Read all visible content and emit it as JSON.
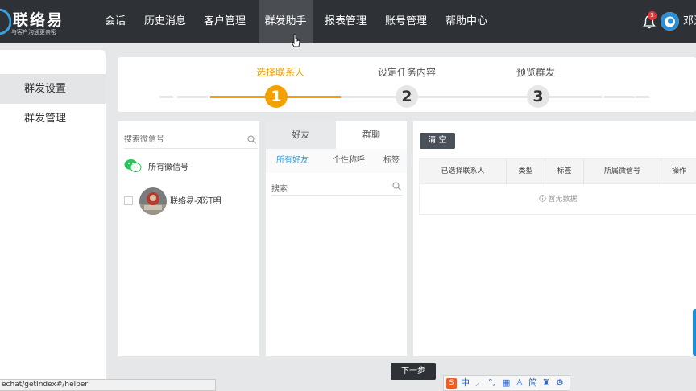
{
  "app": {
    "logo_name": "联络易",
    "logo_slogan": "与客户沟通更亲密",
    "user_name": "邓汀"
  },
  "nav": {
    "items": [
      {
        "label": "会话",
        "active": false
      },
      {
        "label": "历史消息",
        "active": false
      },
      {
        "label": "客户管理",
        "active": false
      },
      {
        "label": "群发助手",
        "active": true
      },
      {
        "label": "报表管理",
        "active": false
      },
      {
        "label": "账号管理",
        "active": false
      },
      {
        "label": "帮助中心",
        "active": false
      }
    ],
    "notification_count": "3"
  },
  "sidebar": {
    "items": [
      {
        "label": "群发设置",
        "active": true
      },
      {
        "label": "群发管理",
        "active": false
      }
    ]
  },
  "steps": {
    "items": [
      {
        "number": "1",
        "label": "选择联系人",
        "active": true
      },
      {
        "number": "2",
        "label": "设定任务内容",
        "active": false
      },
      {
        "number": "3",
        "label": "预览群发",
        "active": false
      }
    ]
  },
  "accounts_panel": {
    "search_placeholder": "搜索微信号",
    "all_label": "所有微信号",
    "accounts": [
      {
        "name": "联络易-邓汀明",
        "checked": false
      }
    ]
  },
  "contacts_panel": {
    "tabs": [
      "好友",
      "群聊"
    ],
    "active_tab": "好友",
    "subtabs": [
      "所有好友",
      "个性称呼",
      "标签"
    ],
    "active_subtab": "所有好友",
    "search_placeholder": "搜索"
  },
  "selected_panel": {
    "clear_label": "清 空",
    "columns": [
      "已选择联系人",
      "类型",
      "标签",
      "所属微信号",
      "操作"
    ],
    "empty_text": "暂无数据"
  },
  "footer": {
    "next_label": "下一步",
    "status_url": "echat/getIndex#/helper"
  },
  "ime": {
    "glyphs": [
      "中",
      "⸝",
      "°,",
      "▦",
      "♙",
      "简",
      "♜",
      "⚙"
    ]
  },
  "colors": {
    "accent": "#f2a100",
    "topbar": "#2e3236",
    "link_blue": "#3aa0dc"
  }
}
